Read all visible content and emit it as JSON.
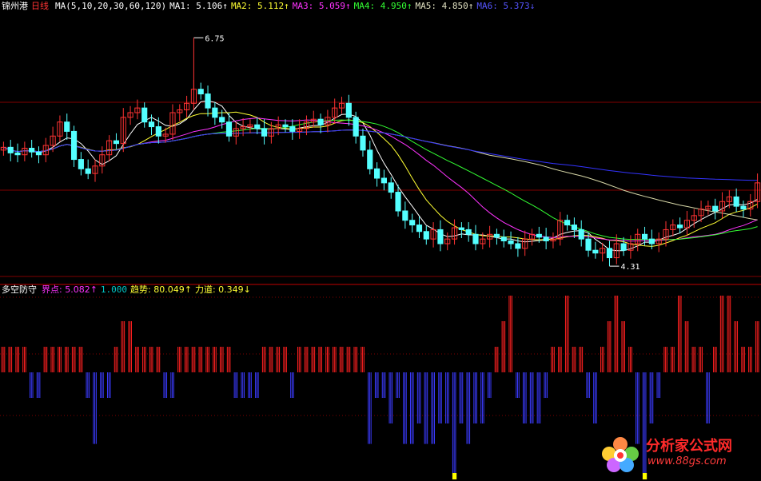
{
  "header": {
    "stock_name": "锦州港",
    "period": "日线",
    "ma_params": "MA(5,10,20,30,60,120)",
    "ma1": "MA1: 5.106↑",
    "ma2": "MA2: 5.112↑",
    "ma3": "MA3: 5.059↑",
    "ma4": "MA4: 4.950↑",
    "ma5": "MA5: 4.850↑",
    "ma6": "MA6: 5.373↓"
  },
  "indicator": {
    "name": "多空防守",
    "jiedian": "界点: 5.082↑",
    "jiedian_ref": "1.000",
    "qushi": "趋势: 80.049↑",
    "lidao": "力道: 0.349↓"
  },
  "annotations": {
    "high": "6.75",
    "low": "4.31"
  },
  "watermark": {
    "name": "分析家公式网",
    "url": "www.88gs.com"
  },
  "colors": {
    "up": "#ff3333",
    "down": "#54ffff",
    "ma1": "#ffffff",
    "ma2": "#ffff33",
    "ma3": "#ff33ff",
    "ma4": "#33ff33",
    "ma5": "#d8d8a8",
    "ma6": "#3333ff",
    "bar_pos": "#ff2020",
    "bar_neg": "#3b3bff",
    "bar_mark": "#ffff00",
    "grid": "#800000"
  },
  "chart_data": {
    "type": "candlestick",
    "price_range": [
      4.2,
      7.0
    ],
    "candles_open": [
      5.55,
      5.58,
      5.52,
      5.5,
      5.57,
      5.53,
      5.5,
      5.6,
      5.7,
      5.85,
      5.75,
      5.45,
      5.35,
      5.3,
      5.38,
      5.5,
      5.65,
      5.62,
      5.9,
      5.95,
      6.0,
      5.85,
      5.8,
      5.7,
      5.72,
      5.95,
      5.98,
      6.05,
      6.2,
      6.15,
      6.0,
      5.9,
      5.85,
      5.7,
      5.78,
      5.8,
      5.82,
      5.78,
      5.7,
      5.78,
      5.82,
      5.8,
      5.75,
      5.78,
      5.85,
      5.88,
      5.82,
      5.9,
      6.0,
      6.05,
      5.9,
      5.7,
      5.55,
      5.35,
      5.25,
      5.2,
      5.1,
      4.9,
      4.8,
      4.75,
      4.68,
      4.6,
      4.7,
      4.55,
      4.6,
      4.72,
      4.7,
      4.65,
      4.55,
      4.6,
      4.65,
      4.62,
      4.58,
      4.55,
      4.5,
      4.6,
      4.65,
      4.62,
      4.58,
      4.6,
      4.8,
      4.75,
      4.7,
      4.6,
      4.48,
      4.45,
      4.5,
      4.4,
      4.55,
      4.48,
      4.55,
      4.65,
      4.6,
      4.55,
      4.6,
      4.7,
      4.75,
      4.72,
      4.8,
      4.85,
      4.92,
      4.95,
      4.9,
      5.0,
      5.05,
      4.95,
      4.92,
      5.0
    ],
    "candles_close": [
      5.58,
      5.52,
      5.5,
      5.57,
      5.53,
      5.5,
      5.6,
      5.7,
      5.85,
      5.75,
      5.45,
      5.35,
      5.3,
      5.38,
      5.5,
      5.65,
      5.62,
      5.9,
      5.95,
      6.0,
      5.85,
      5.8,
      5.7,
      5.72,
      5.95,
      5.98,
      6.05,
      6.2,
      6.15,
      6.0,
      5.9,
      5.85,
      5.7,
      5.78,
      5.8,
      5.82,
      5.78,
      5.7,
      5.78,
      5.82,
      5.8,
      5.75,
      5.78,
      5.85,
      5.88,
      5.82,
      5.9,
      6.0,
      6.05,
      5.9,
      5.7,
      5.55,
      5.35,
      5.25,
      5.2,
      5.1,
      4.9,
      4.8,
      4.75,
      4.68,
      4.6,
      4.7,
      4.55,
      4.6,
      4.72,
      4.7,
      4.65,
      4.55,
      4.6,
      4.65,
      4.62,
      4.58,
      4.55,
      4.5,
      4.6,
      4.65,
      4.62,
      4.58,
      4.6,
      4.8,
      4.75,
      4.7,
      4.6,
      4.48,
      4.45,
      4.5,
      4.4,
      4.55,
      4.48,
      4.55,
      4.65,
      4.6,
      4.55,
      4.6,
      4.7,
      4.75,
      4.72,
      4.8,
      4.85,
      4.92,
      4.95,
      4.9,
      5.0,
      5.05,
      4.95,
      4.92,
      5.0,
      5.2
    ],
    "high_point": 6.75,
    "low_point": 4.31,
    "indicator_bars": [
      1.0,
      1.0,
      1.0,
      1.0,
      -1.0,
      -1.0,
      1.0,
      1.0,
      1.0,
      1.0,
      1.0,
      1.0,
      -1.0,
      -2.8,
      -1.0,
      -1.0,
      1.0,
      2.0,
      2.0,
      1.0,
      1.0,
      1.0,
      1.0,
      -1.0,
      -1.0,
      1.0,
      1.0,
      1.0,
      1.0,
      1.0,
      1.0,
      1.0,
      1.0,
      -1.0,
      -1.0,
      -1.0,
      -1.0,
      1.0,
      1.0,
      1.0,
      1.0,
      -1.0,
      1.0,
      1.0,
      1.0,
      1.0,
      1.0,
      1.0,
      1.0,
      1.0,
      1.0,
      1.0,
      -2.8,
      -1.0,
      -1.0,
      -2.0,
      -1.0,
      -2.8,
      -2.8,
      -2.0,
      -2.8,
      -2.8,
      -2.0,
      -2.0,
      -4.0,
      -2.0,
      -2.8,
      -2.0,
      -2.0,
      -1.0,
      1.0,
      2.0,
      3.0,
      -1.0,
      -2.0,
      -2.0,
      -2.0,
      -1.0,
      1.0,
      1.0,
      3.0,
      1.0,
      1.0,
      -1.0,
      -2.0,
      1.0,
      2.0,
      3.0,
      2.0,
      1.0,
      -2.8,
      -4.0,
      -2.0,
      -1.0,
      1.0,
      1.0,
      3.0,
      2.0,
      1.0,
      1.0,
      -2.0,
      1.0,
      3.0,
      3.0,
      2.0,
      1.0,
      1.0,
      2.0
    ]
  }
}
